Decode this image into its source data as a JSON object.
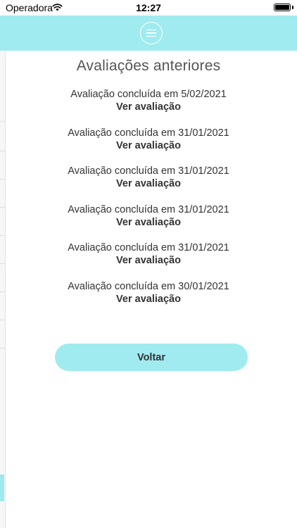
{
  "status_bar": {
    "carrier": "Operadora",
    "time": "12:27"
  },
  "page": {
    "title": "Avaliações anteriores"
  },
  "evaluations": [
    {
      "date_text": "Avaliação concluída em 5/02/2021",
      "link_label": "Ver avaliação"
    },
    {
      "date_text": "Avaliação concluída em 31/01/2021",
      "link_label": "Ver avaliação"
    },
    {
      "date_text": "Avaliação concluída em 31/01/2021",
      "link_label": "Ver avaliação"
    },
    {
      "date_text": "Avaliação concluída em 31/01/2021",
      "link_label": "Ver avaliação"
    },
    {
      "date_text": "Avaliação concluída em 31/01/2021",
      "link_label": "Ver avaliação"
    },
    {
      "date_text": "Avaliação concluída em 30/01/2021",
      "link_label": "Ver avaliação"
    }
  ],
  "actions": {
    "back_label": "Voltar"
  },
  "icons": {
    "menu": "hamburger-menu-icon",
    "wifi": "wifi-icon",
    "battery": "battery-icon"
  },
  "colors": {
    "accent": "#a0ebef",
    "text": "#333333",
    "title": "#555555"
  }
}
